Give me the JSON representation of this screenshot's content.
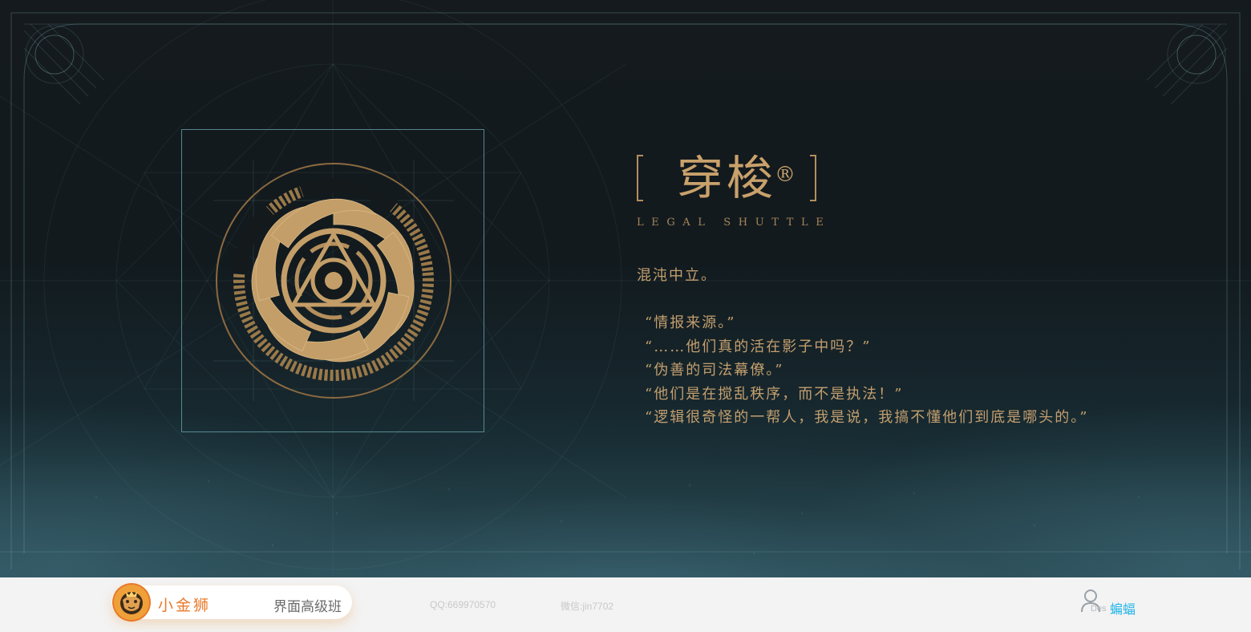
{
  "title": {
    "main": "穿梭",
    "registered_mark": "®",
    "subtitle": "LEGAL SHUTTLE"
  },
  "lore": {
    "intro": "混沌中立。",
    "quotes": [
      "“情报来源。”",
      "“……他们真的活在影子中吗？”",
      "“伪善的司法幕僚。”",
      "“他们是在搅乱秩序，而不是执法！”",
      "“逻辑很奇怪的一帮人，我是说，我搞不懂他们到底是哪头的。”"
    ]
  },
  "emblem": {
    "icon": "shuttle-vortex-emblem-icon"
  },
  "footer": {
    "brand_name": "小金狮",
    "course": "界面高级班",
    "qq": "QQ:669970570",
    "wechat": "微信:jin7702",
    "des_label": "Des",
    "author": "蝙蝠",
    "icons": {
      "logo": "lion-logo-icon",
      "user": "user-icon"
    }
  },
  "colors": {
    "gold": "#c9a16b",
    "frame_teal": "#6eaab4",
    "background": "#121a1e",
    "footer_bg": "#f3f3f3",
    "brand_orange": "#e8792a",
    "author_blue": "#23b5e8"
  }
}
